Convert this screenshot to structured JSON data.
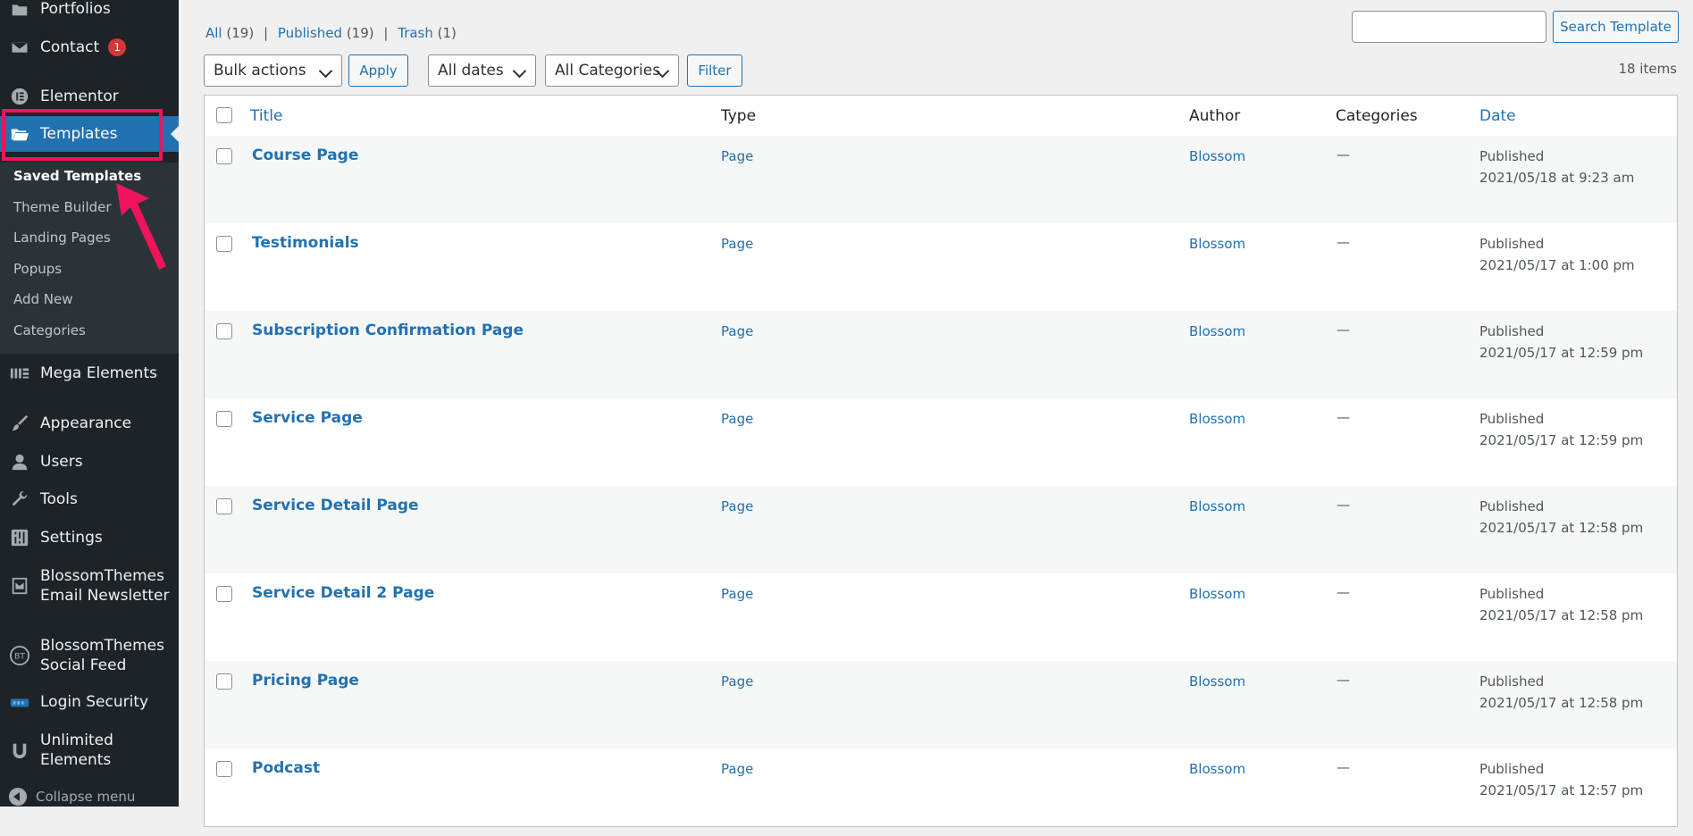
{
  "sidebar": {
    "items": [
      {
        "label": "Portfolios",
        "icon": "portfolio-icon"
      },
      {
        "label": "Contact",
        "icon": "mail-icon",
        "badge": "1"
      },
      {
        "label": "Elementor",
        "icon": "elementor-icon"
      },
      {
        "label": "Templates",
        "icon": "folder-open-icon",
        "active": true
      },
      {
        "label": "Mega Elements",
        "icon": "mega-elements-icon"
      },
      {
        "label": "Appearance",
        "icon": "brush-icon"
      },
      {
        "label": "Users",
        "icon": "user-icon"
      },
      {
        "label": "Tools",
        "icon": "wrench-icon"
      },
      {
        "label": "Settings",
        "icon": "settings-sliders-icon"
      },
      {
        "label": "BlossomThemes Email Newsletter",
        "line1": "BlossomThemes",
        "line2": "Email Newsletter",
        "icon": "newsletter-icon"
      },
      {
        "label": "BlossomThemes Social Feed",
        "line1": "BlossomThemes",
        "line2": "Social Feed",
        "icon": "bt-icon"
      },
      {
        "label": "Login Security",
        "icon": "login-security-icon"
      },
      {
        "label": "Unlimited Elements",
        "line1": "Unlimited",
        "line2": "Elements",
        "icon": "unlimited-elements-icon"
      }
    ],
    "submenu": [
      {
        "label": "Saved Templates",
        "current": true
      },
      {
        "label": "Theme Builder"
      },
      {
        "label": "Landing Pages"
      },
      {
        "label": "Popups"
      },
      {
        "label": "Add New"
      },
      {
        "label": "Categories"
      }
    ],
    "collapse_label": "Collapse menu"
  },
  "filters": {
    "all": "All",
    "all_count": "(19)",
    "published": "Published",
    "published_count": "(19)",
    "trash": "Trash",
    "trash_count": "(1)",
    "separator": "|"
  },
  "search": {
    "placeholder": "",
    "button": "Search Template"
  },
  "toolbar": {
    "bulk_actions": "Bulk actions",
    "apply": "Apply",
    "dates": "All dates",
    "categories": "All Categories",
    "filter": "Filter",
    "items_count": "18 items"
  },
  "table": {
    "columns": {
      "title": "Title",
      "type": "Type",
      "author": "Author",
      "categories": "Categories",
      "date": "Date"
    },
    "rows": [
      {
        "title": "Course Page",
        "type": "Page",
        "author": "Blossom",
        "categories": "—",
        "status": "Published",
        "date": "2021/05/18 at 9:23 am"
      },
      {
        "title": "Testimonials",
        "type": "Page",
        "author": "Blossom",
        "categories": "—",
        "status": "Published",
        "date": "2021/05/17 at 1:00 pm"
      },
      {
        "title": "Subscription Confirmation Page",
        "type": "Page",
        "author": "Blossom",
        "categories": "—",
        "status": "Published",
        "date": "2021/05/17 at 12:59 pm"
      },
      {
        "title": "Service Page",
        "type": "Page",
        "author": "Blossom",
        "categories": "—",
        "status": "Published",
        "date": "2021/05/17 at 12:59 pm"
      },
      {
        "title": "Service Detail Page",
        "type": "Page",
        "author": "Blossom",
        "categories": "—",
        "status": "Published",
        "date": "2021/05/17 at 12:58 pm"
      },
      {
        "title": "Service Detail 2 Page",
        "type": "Page",
        "author": "Blossom",
        "categories": "—",
        "status": "Published",
        "date": "2021/05/17 at 12:58 pm"
      },
      {
        "title": "Pricing Page",
        "type": "Page",
        "author": "Blossom",
        "categories": "—",
        "status": "Published",
        "date": "2021/05/17 at 12:58 pm"
      },
      {
        "title": "Podcast",
        "type": "Page",
        "author": "Blossom",
        "categories": "—",
        "status": "Published",
        "date": "2021/05/17 at 12:57 pm"
      }
    ]
  },
  "colors": {
    "sidebar_bg": "#1d2327",
    "submenu_bg": "#2c3338",
    "active_bg": "#2271b1",
    "highlight": "#f0145a",
    "link": "#2271b1"
  }
}
